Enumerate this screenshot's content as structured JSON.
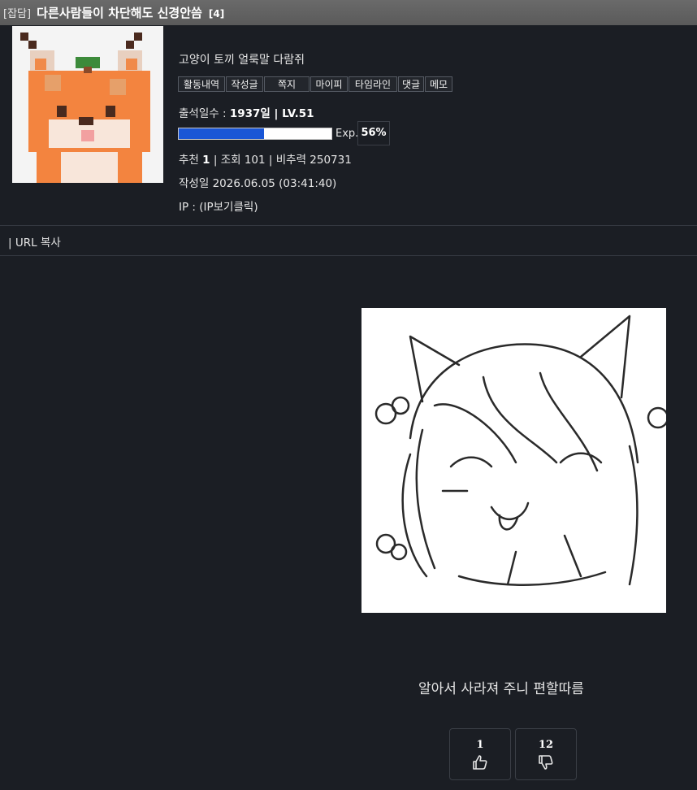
{
  "post": {
    "category": "[잡담]",
    "title": "다른사람들이 차단해도 신경안씀",
    "comment_count": "[4]",
    "body_text": "알아서 사라져 주니 편할따름"
  },
  "author": {
    "nickname": "고양이 토끼 얼룩말 다람쥐",
    "actions": [
      "활동내역",
      "작성글",
      "쪽지",
      "마이피",
      "타임라인",
      "댓글",
      "메모"
    ],
    "attendance_label": "출석일수 : ",
    "attendance_value": "1937일",
    "level": "LV.51",
    "exp_label": "Exp.",
    "exp_percent": "56%",
    "exp_fraction": 0.56
  },
  "stats": {
    "recommend_label": "추천",
    "recommend_value": "1",
    "views": "조회 101",
    "bichuryeok": "비추력 250731",
    "date_label": "작성일",
    "date_value": "2026.06.05 (03:41:40)",
    "ip": "IP : (IP보기클릭)"
  },
  "toolbar": {
    "url_copy": "| URL 복사"
  },
  "votes": {
    "up": "1",
    "down": "12"
  },
  "icons": {
    "up": "thumbs-up-icon",
    "down": "thumbs-down-icon"
  },
  "colors": {
    "exp_bar": "#1a56d6",
    "title_bar": "#5f5f5f",
    "background": "#1b1e24"
  }
}
